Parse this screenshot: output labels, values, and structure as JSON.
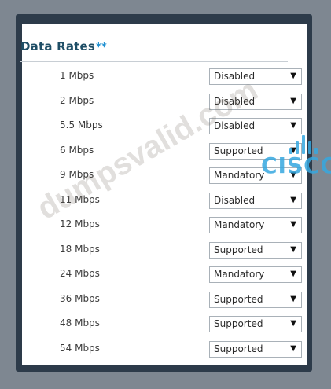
{
  "section": {
    "title": "Data Rates",
    "required_marker": "**"
  },
  "rates": [
    {
      "label": "1 Mbps",
      "value": "Disabled"
    },
    {
      "label": "2 Mbps",
      "value": "Disabled"
    },
    {
      "label": "5.5 Mbps",
      "value": "Disabled"
    },
    {
      "label": "6 Mbps",
      "value": "Supported"
    },
    {
      "label": "9 Mbps",
      "value": "Mandatory"
    },
    {
      "label": "11 Mbps",
      "value": "Disabled"
    },
    {
      "label": "12 Mbps",
      "value": "Mandatory"
    },
    {
      "label": "18 Mbps",
      "value": "Supported"
    },
    {
      "label": "24 Mbps",
      "value": "Mandatory"
    },
    {
      "label": "36 Mbps",
      "value": "Supported"
    },
    {
      "label": "48 Mbps",
      "value": "Supported"
    },
    {
      "label": "54 Mbps",
      "value": "Supported"
    }
  ],
  "watermark": "dumpsvalid.com",
  "brand_logo": "CISCO",
  "colors": {
    "title": "#1f4e66",
    "required_marker": "#1d8fd1",
    "frame": "#2d3b4a",
    "logo": "#36a8e0"
  }
}
